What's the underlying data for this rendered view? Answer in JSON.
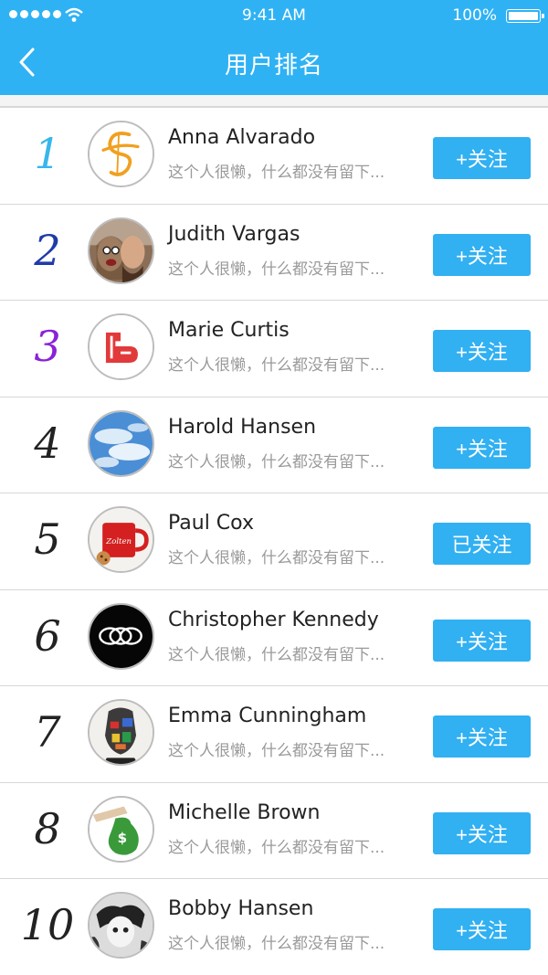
{
  "status_bar": {
    "time": "9:41 AM",
    "battery": "100%"
  },
  "header": {
    "title": "用户排名"
  },
  "colors": {
    "accent": "#2fb2f4",
    "rank1": "#37b6ec",
    "rank2": "#1f3ba8",
    "rank3": "#8a22d8",
    "rank_default": "#222222"
  },
  "users": [
    {
      "rank": "1",
      "name": "Anna Alvarado",
      "bio": "这个人很懒，什么都没有留下...",
      "button": "+关注",
      "avatar": "logo-s-icon"
    },
    {
      "rank": "2",
      "name": "Judith Vargas",
      "bio": "这个人很懒，什么都没有留下...",
      "button": "+关注",
      "avatar": "couple-photo"
    },
    {
      "rank": "3",
      "name": "Marie Curtis",
      "bio": "这个人很懒，什么都没有留下...",
      "button": "+关注",
      "avatar": "hand-logo-icon"
    },
    {
      "rank": "4",
      "name": "Harold Hansen",
      "bio": "这个人很懒，什么都没有留下...",
      "button": "+关注",
      "avatar": "sky-photo"
    },
    {
      "rank": "5",
      "name": "Paul Cox",
      "bio": "这个人很懒，什么都没有留下...",
      "button": "已关注",
      "avatar": "mug-photo",
      "mug_text": "Zolten"
    },
    {
      "rank": "6",
      "name": "Christopher Kennedy",
      "bio": "这个人很懒，什么都没有留下...",
      "button": "+关注",
      "avatar": "black-logo-icon"
    },
    {
      "rank": "7",
      "name": "Emma Cunningham",
      "bio": "这个人很懒，什么都没有留下...",
      "button": "+关注",
      "avatar": "art-portrait"
    },
    {
      "rank": "8",
      "name": "Michelle Brown",
      "bio": "这个人很懒，什么都没有留下...",
      "button": "+关注",
      "avatar": "money-bag-icon"
    },
    {
      "rank": "10",
      "name": "Bobby Hansen",
      "bio": "这个人很懒，什么都没有留下...",
      "button": "+关注",
      "avatar": "bw-portrait"
    }
  ]
}
